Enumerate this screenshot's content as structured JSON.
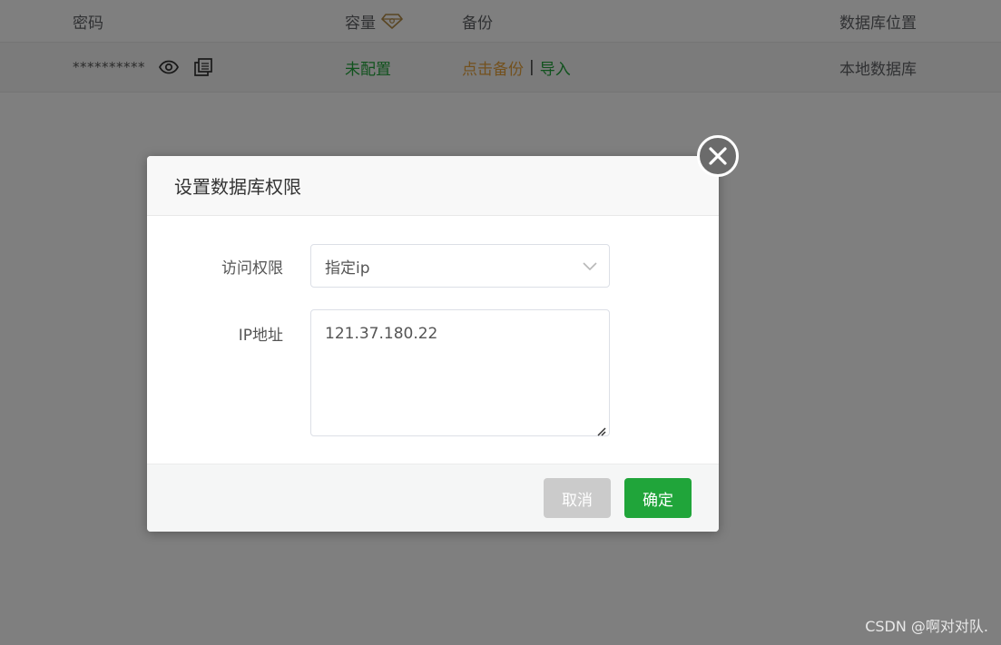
{
  "table": {
    "headers": {
      "password": "密码",
      "capacity": "容量",
      "backup": "备份",
      "location": "数据库位置"
    },
    "rows": [
      {
        "password_mask": "**********",
        "capacity": "未配置",
        "backup_link": "点击备份",
        "separator": "|",
        "import_link": "导入",
        "location": "本地数据库"
      }
    ]
  },
  "dialog": {
    "title": "设置数据库权限",
    "access": {
      "label": "访问权限",
      "selected": "指定ip"
    },
    "ip": {
      "label": "IP地址",
      "value": "121.37.180.22"
    },
    "buttons": {
      "cancel": "取消",
      "confirm": "确定"
    }
  },
  "watermark": "CSDN @啊对对队.",
  "colors": {
    "accent_green": "#20a53a",
    "orange_link": "#e6a23c",
    "cancel_gray": "#cbcbcb"
  },
  "icons": [
    "eye-icon",
    "copy-icon",
    "gem-icon",
    "close-icon",
    "chevron-down-icon"
  ]
}
